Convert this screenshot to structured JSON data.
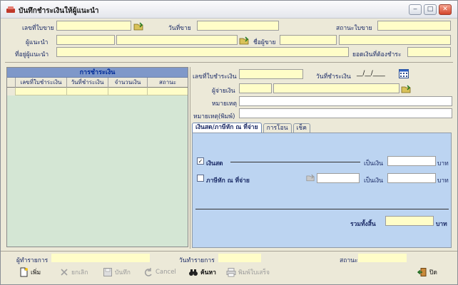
{
  "window": {
    "title": "บันทึกชำระเงินให้ผู้แนะนำ",
    "min_glyph": "‒",
    "max_glyph": "□",
    "close_glyph": "✕"
  },
  "header": {
    "receipt_no_label": "เลขที่ใบขาย",
    "sale_date_label": "วันที่ขาย",
    "receipt_status_label": "สถานะใบขาย",
    "referrer_label": "ผู้แนะนำ",
    "buyer_name_label": "ชื่อผู้ขาย",
    "referrer_address_label": "ที่อยู่ผู้แนะนำ",
    "amount_due_label": "ยอดเงินที่ต้องชำระ"
  },
  "payment_grid": {
    "title": "การชำระเงิน",
    "columns": [
      "เลขที่ใบชำระเงิน",
      "วันที่ชำระเงิน",
      "จำนวนเงิน",
      "สถานะ"
    ]
  },
  "payment_detail": {
    "payment_no_label": "เลขที่ใบชำระเงิน",
    "payment_date_label": "วันที่ชำระเงิน",
    "payment_date_value": "__/__/____",
    "payer_label": "ผู้จ่ายเงิน",
    "note_label": "หมายเหตุ",
    "print_note_label": "หมายเหตุ(พิมพ์)"
  },
  "tabs": [
    "เงินสด/ภาษีหัก ณ ที่จ่าย",
    "การโอน",
    "เช็ค"
  ],
  "cash_tab": {
    "cash_label": "เงินสด",
    "cash_checked": "✓",
    "amount_label": "เป็นเงิน",
    "baht": "บาท",
    "withholding_label": "ภาษีหัก ณ ที่จ่าย",
    "total_label": "รวมทั้งสิ้น"
  },
  "footer": {
    "creator_label": "ผู้ทำรายการ",
    "trans_date_label": "วันทำรายการ",
    "status_label": "สถานะ"
  },
  "toolbar": {
    "add": "เพิ่ม",
    "cancel_th": "ยกเลิก",
    "save": "บันทึก",
    "cancel_en": "Cancel",
    "search": "ค้นหา",
    "print_receipt": "พิมพ์ใบเสร็จ",
    "close": "ปิด"
  },
  "colors": {
    "field_yellow": "#fffdc8",
    "grid_title_bg": "#7f98c9",
    "tab_body_bg": "#bcd4f1",
    "grid_body_bg": "#d4e6d4",
    "label_blue": "#1a2a66"
  }
}
